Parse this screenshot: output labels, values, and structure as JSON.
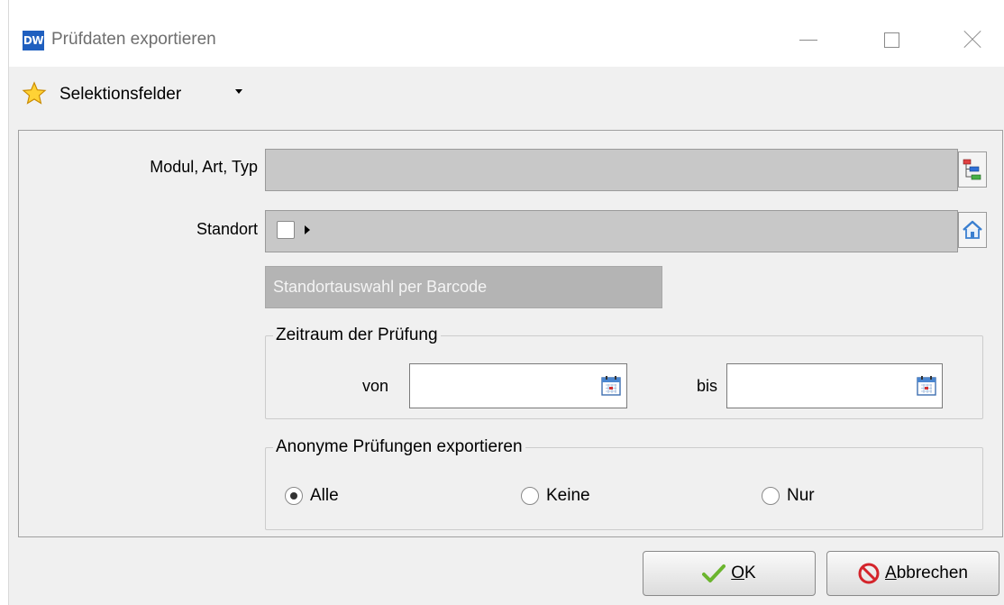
{
  "window": {
    "app_icon": "DW",
    "title": "Prüfdaten exportieren"
  },
  "toolbar": {
    "selection_label": "Selektionsfelder"
  },
  "form": {
    "modul_label": "Modul, Art, Typ",
    "modul_value": "",
    "standort_label": "Standort",
    "barcode_placeholder": "Standortauswahl per Barcode"
  },
  "zeitraum": {
    "title": "Zeitraum der Prüfung",
    "von_label": "von",
    "von_value": "",
    "bis_label": "bis",
    "bis_value": ""
  },
  "anonym": {
    "title": "Anonyme Prüfungen exportieren",
    "options": [
      "Alle",
      "Keine",
      "Nur"
    ],
    "selected": "Alle"
  },
  "buttons": {
    "ok_accel": "O",
    "ok_rest": "K",
    "cancel_accel": "A",
    "cancel_rest": "bbrechen"
  },
  "colors": {
    "field_gray": "#c8c8c8",
    "barcode_gray": "#b4b4b4",
    "app_icon_blue": "#1f5fbf",
    "ok_green": "#6bb52e",
    "cancel_red": "#d4242b"
  },
  "icons": {
    "app": "dw-app-icon",
    "favorite": "star-icon",
    "dropdown": "caret-down-icon",
    "modul_picker": "tree-icon",
    "standort_picker": "home-icon",
    "standort_expand": "triangle-right-icon",
    "date_picker": "calendar-icon",
    "ok": "checkmark-icon",
    "cancel": "prohibited-icon"
  }
}
